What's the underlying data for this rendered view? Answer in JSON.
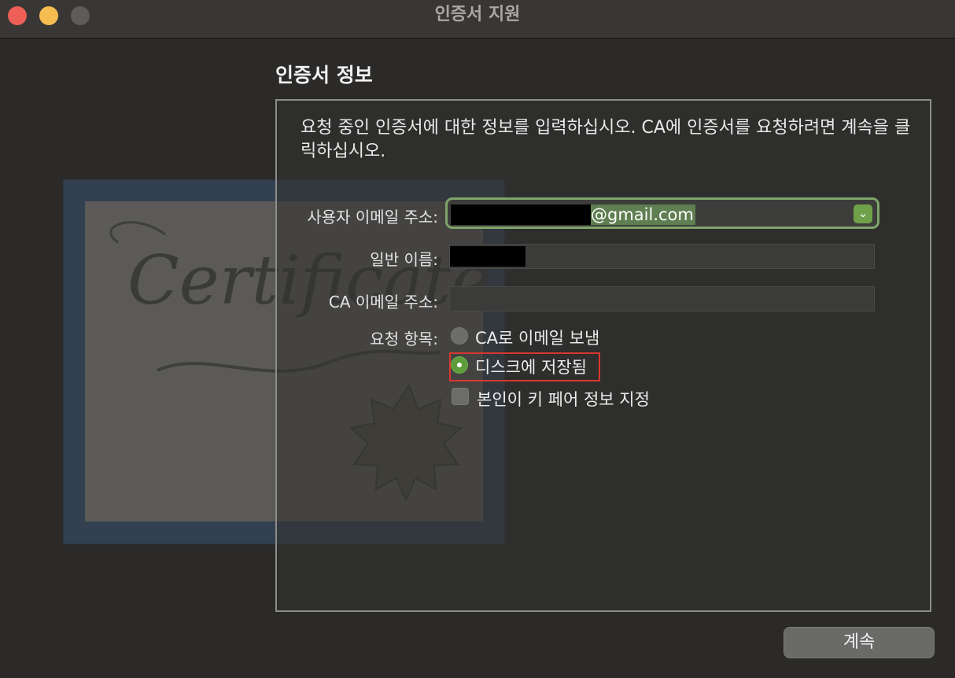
{
  "window": {
    "title": "인증서 지원"
  },
  "section": {
    "title": "인증서 정보",
    "description": "요청 중인 인증서에 대한 정보를 입력하십시오. CA에 인증서를 요청하려면 계속을 클릭하십시오."
  },
  "background_art": {
    "certificate_text": "Certificate"
  },
  "form": {
    "email_label": "사용자 이메일 주소:",
    "email_value": "@gmail.com",
    "common_name_label": "일반 이름:",
    "ca_email_label": "CA 이메일 주소:",
    "ca_email_value": "",
    "request_label": "요청 항목:",
    "options": {
      "email_ca": "CA로 이메일 보냄",
      "save_disk": "디스크에 저장됨",
      "specify_key": "본인이 키 페어 정보 지정"
    },
    "selected_option": "디스크에 저장됨"
  },
  "footer": {
    "continue_label": "계속"
  },
  "colors": {
    "accent": "#6fa14a",
    "highlight_border": "#d9372f"
  }
}
